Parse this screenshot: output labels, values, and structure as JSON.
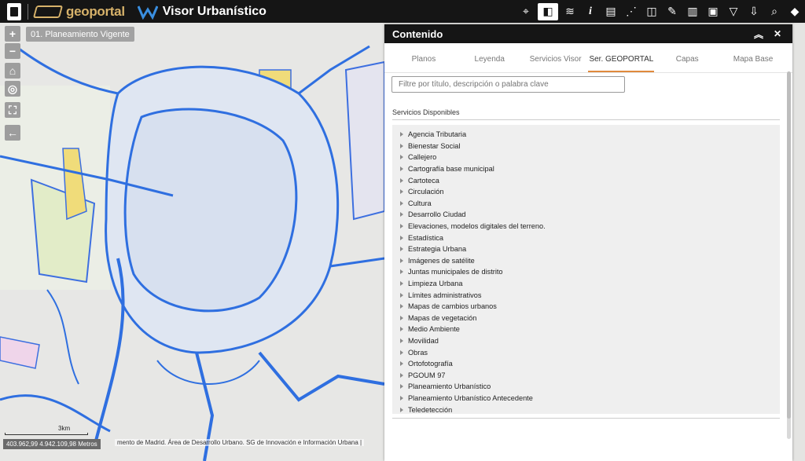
{
  "topbar": {
    "geoportal_label": "geoportal",
    "app_title": "Visor Urbanístico",
    "tools": [
      "location-pin-icon",
      "map-select-icon",
      "layers-icon",
      "info-icon",
      "clipboard-icon",
      "draw-icon",
      "compare-icon",
      "map-edit-icon",
      "buildings-icon",
      "briefcase-icon",
      "filter-icon",
      "download-icon",
      "search-map-icon",
      "graduation-cap-icon"
    ]
  },
  "map": {
    "plan_label": "01. Planeamiento Vigente",
    "scale_label": "3km",
    "coords_text": "403.962,99 4.942.109,98 Metros",
    "attribution": "mento de Madrid. Área de Desarrollo Urbano. SG de Innovación e Información Urbana |",
    "zoom_in": "+",
    "zoom_out": "−"
  },
  "panel": {
    "title": "Contenido",
    "tabs": [
      "Planos",
      "Leyenda",
      "Servicios Visor",
      "Ser. GEOPORTAL",
      "Capas",
      "Mapa Base"
    ],
    "active_tab": "Ser. GEOPORTAL",
    "filter_placeholder": "Filtre por título, descripción o palabra clave",
    "services_title": "Servicios Disponibles",
    "services": [
      "Agencia Tributaria",
      "Bienestar Social",
      "Callejero",
      "Cartografía base municipal",
      "Cartoteca",
      "Circulación",
      "Cultura",
      "Desarrollo Ciudad",
      "Elevaciones, modelos digitales del terreno.",
      "Estadística",
      "Estrategia Urbana",
      "Imágenes de satélite",
      "Juntas municipales de distrito",
      "Limpieza Urbana",
      "Límites administrativos",
      "Mapas de cambios urbanos",
      "Mapas de vegetación",
      "Medio Ambiente",
      "Movilidad",
      "Obras",
      "Ortofotografía",
      "PGOUM 97",
      "Planeamiento Urbanístico",
      "Planeamiento Urbanístico Antecedente",
      "Teledetección"
    ]
  },
  "colors": {
    "topbar": "#151515",
    "accent": "#e08a3c",
    "map_blue": "#2f6fe0"
  }
}
